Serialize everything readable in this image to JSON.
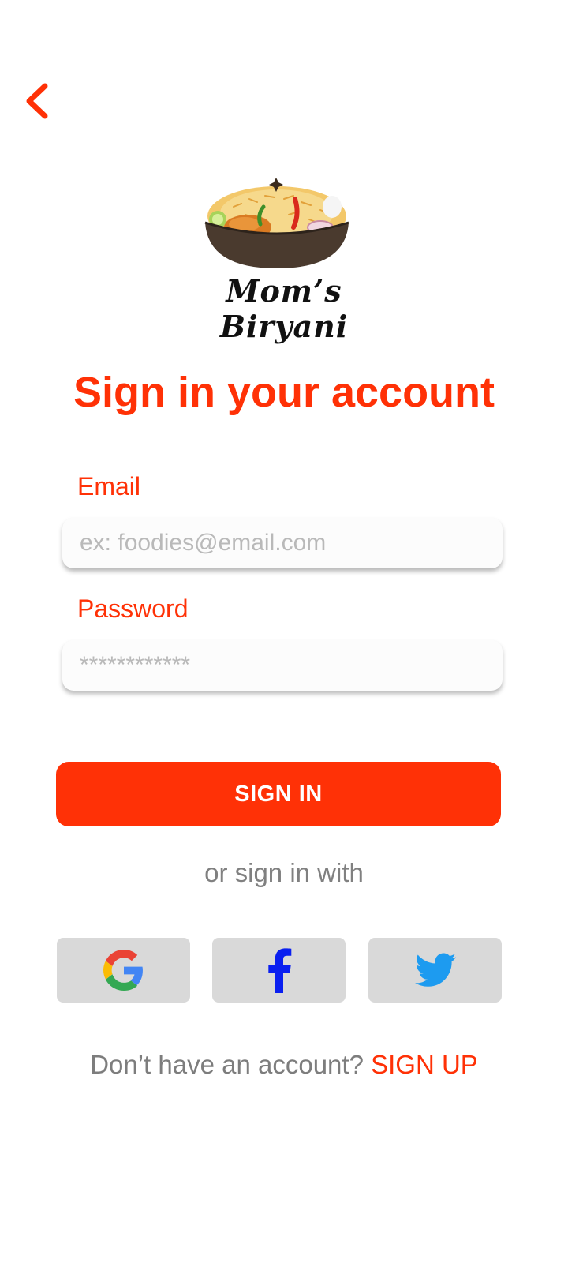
{
  "header": {
    "back_icon": "chevron-left-icon"
  },
  "brand": {
    "name": "Mom’s Biryani",
    "logo_icon": "biryani-bowl-icon"
  },
  "page": {
    "title": "Sign in your account"
  },
  "form": {
    "email": {
      "label": "Email",
      "placeholder": "ex: foodies@email.com",
      "value": ""
    },
    "password": {
      "label": "Password",
      "placeholder": "************",
      "value": ""
    },
    "submit_label": "SIGN IN"
  },
  "social": {
    "divider_text": "or sign in with",
    "providers": [
      {
        "name": "Google",
        "icon": "google-icon"
      },
      {
        "name": "Facebook",
        "icon": "facebook-icon"
      },
      {
        "name": "Twitter",
        "icon": "twitter-icon"
      }
    ]
  },
  "footer": {
    "prompt": "Don’t have an account? ",
    "signup_label": "SIGN UP"
  },
  "colors": {
    "accent": "#ff3106",
    "muted_text": "#808080",
    "social_button_bg": "#d9d9d9",
    "facebook_blue": "#0a1ff0",
    "twitter_blue": "#1d9bf0"
  }
}
